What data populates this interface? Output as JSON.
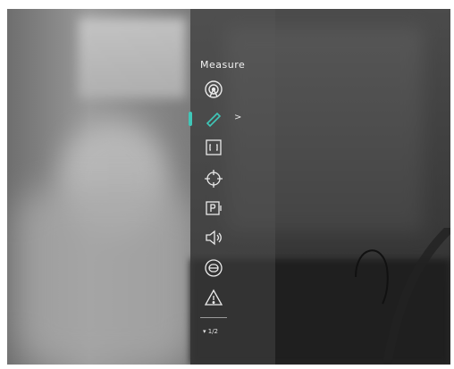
{
  "menu": {
    "title": "Measure",
    "items": [
      {
        "icon": "target-signal-icon"
      },
      {
        "icon": "measure-tool-icon",
        "selected": true,
        "submenu_indicator": ">"
      },
      {
        "icon": "frame-brackets-icon"
      },
      {
        "icon": "crosshair-icon"
      },
      {
        "icon": "parking-icon"
      },
      {
        "icon": "volume-icon"
      },
      {
        "icon": "display-mode-icon"
      },
      {
        "icon": "warning-icon"
      }
    ],
    "page_indicator": "▾ 1/2"
  },
  "colors": {
    "accent": "#3fc7b8",
    "icon_stroke": "#eaeaea"
  }
}
